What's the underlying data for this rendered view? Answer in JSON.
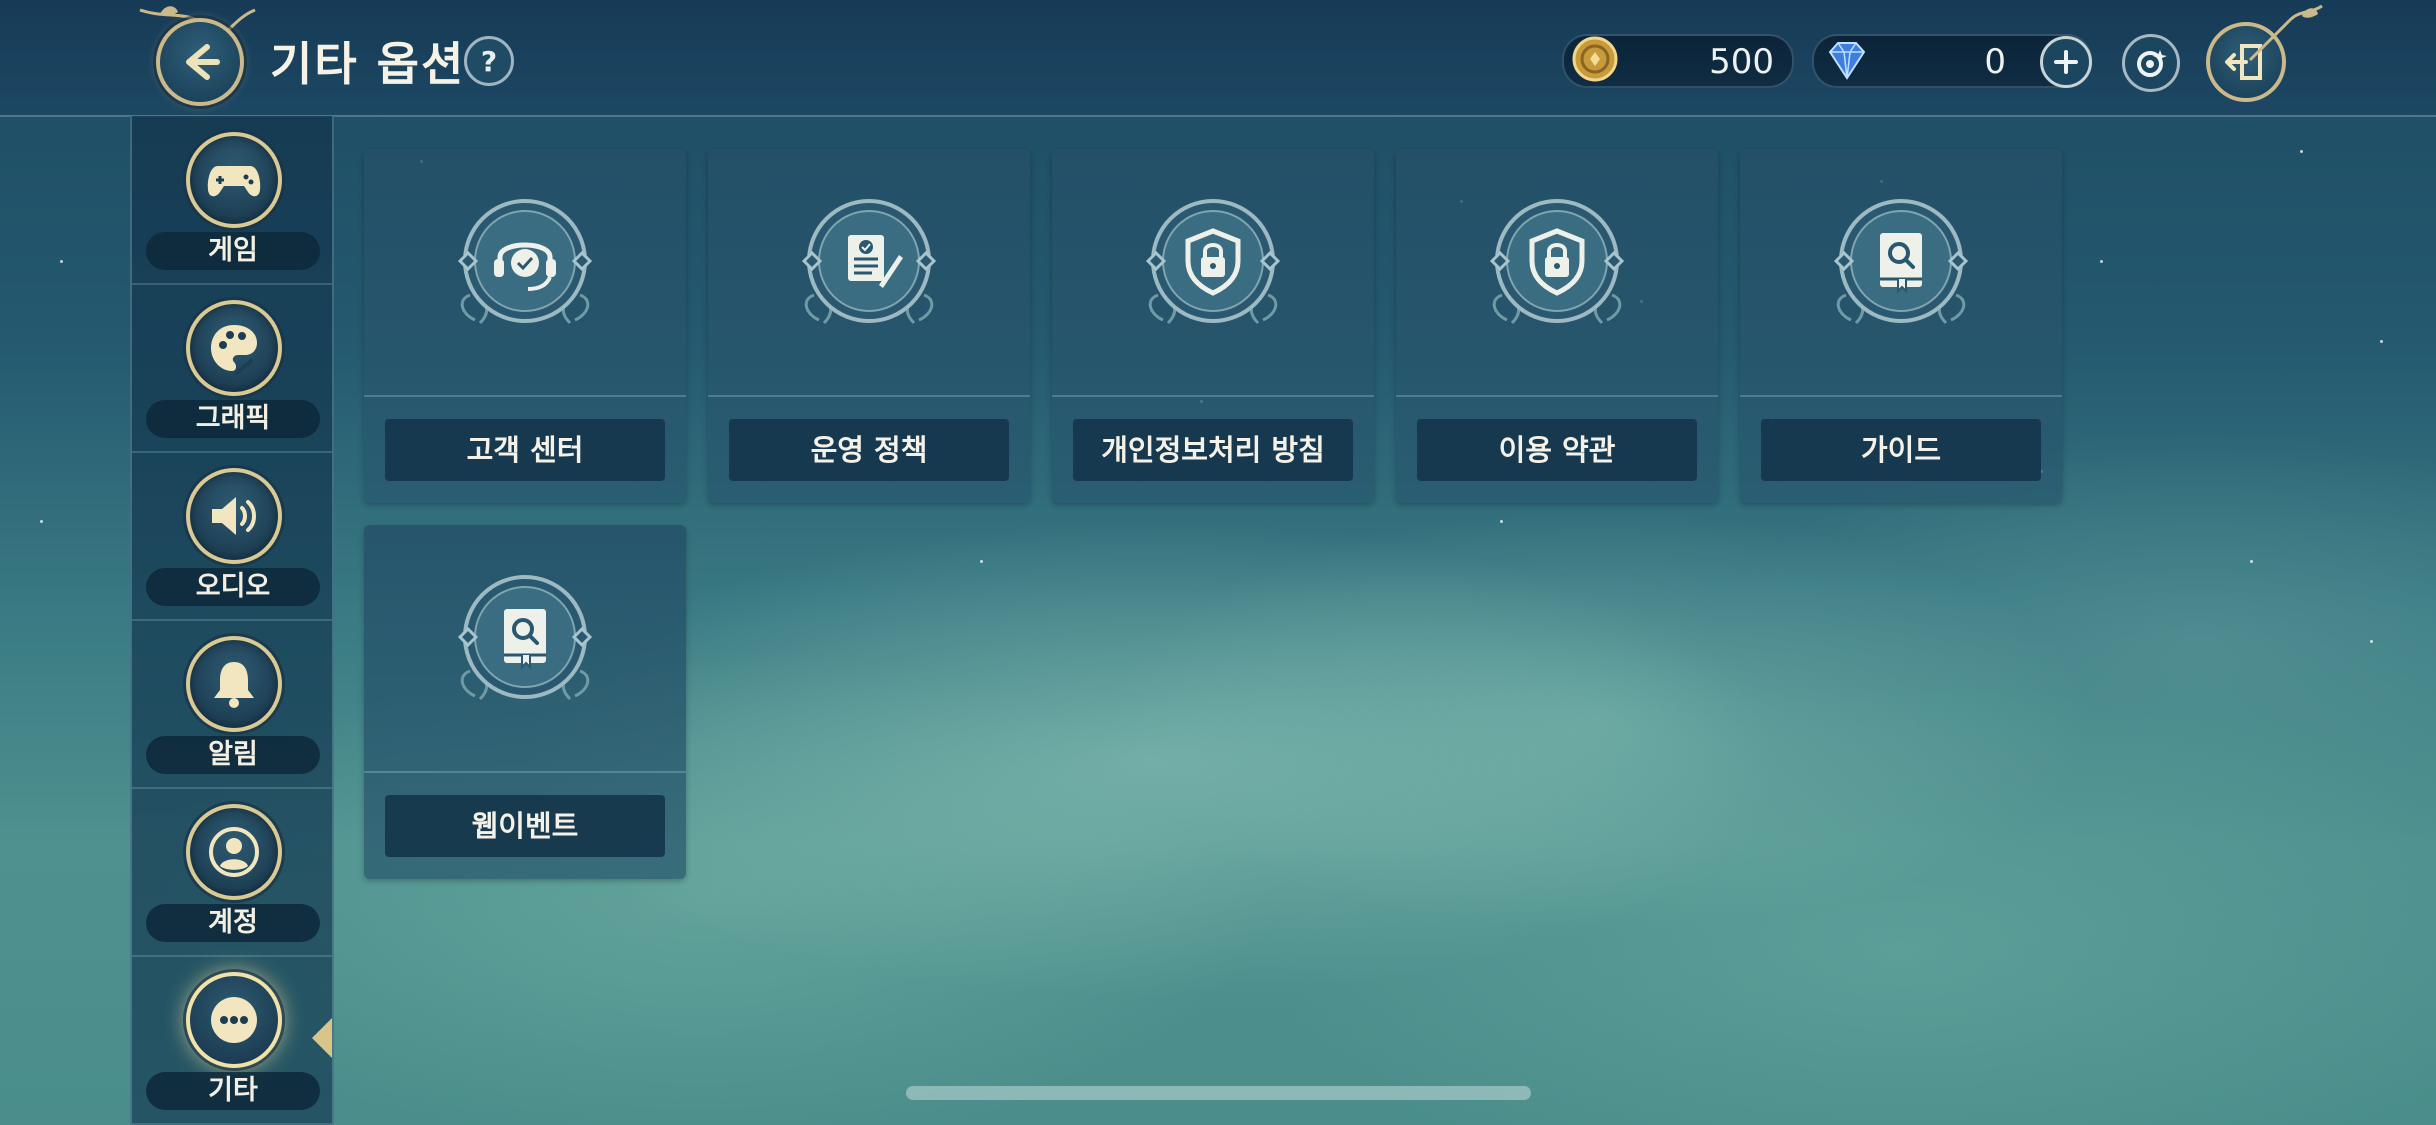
{
  "header": {
    "title": "기타 옵션",
    "help_label": "?",
    "gold": "500",
    "gems": "0"
  },
  "sidebar": {
    "items": [
      {
        "label": "게임",
        "icon": "gamepad-icon"
      },
      {
        "label": "그래픽",
        "icon": "palette-icon"
      },
      {
        "label": "오디오",
        "icon": "speaker-icon"
      },
      {
        "label": "알림",
        "icon": "bell-icon"
      },
      {
        "label": "계정",
        "icon": "user-icon"
      },
      {
        "label": "기타",
        "icon": "more-icon"
      }
    ],
    "active_index": 5
  },
  "options": [
    {
      "label": "고객 센터",
      "icon": "headset-icon"
    },
    {
      "label": "운영 정책",
      "icon": "document-icon"
    },
    {
      "label": "개인정보처리 방침",
      "icon": "shield-lock-icon"
    },
    {
      "label": "이용 약관",
      "icon": "shield-lock-icon"
    },
    {
      "label": "가이드",
      "icon": "book-search-icon"
    },
    {
      "label": "웹이벤트",
      "icon": "book-search-icon"
    }
  ],
  "colors": {
    "accent_gold": "#d9c993",
    "panel": "#24506a"
  }
}
